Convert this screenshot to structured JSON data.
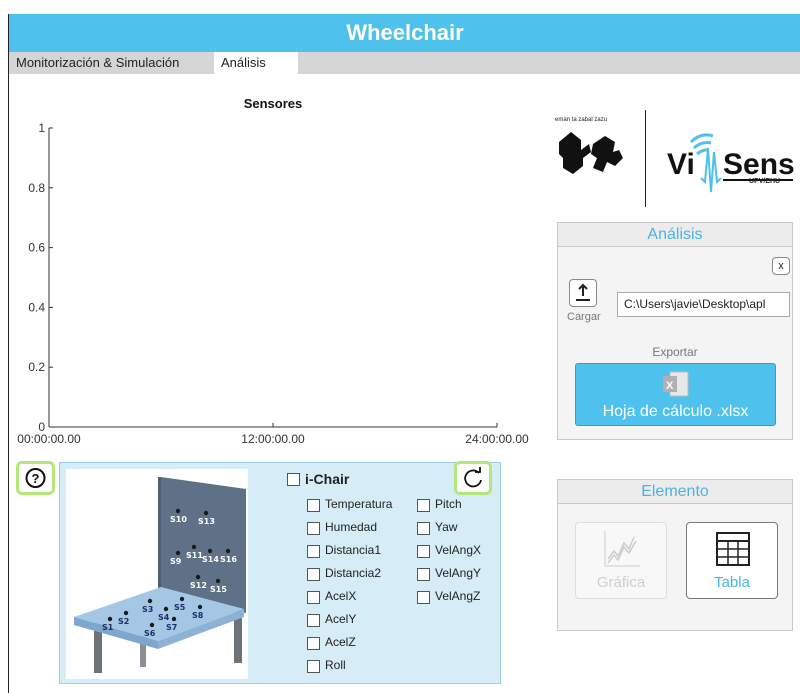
{
  "app": {
    "title": "Wheelchair"
  },
  "tabs": [
    {
      "label": "Monitorización & Simulación"
    },
    {
      "label": "Análisis"
    }
  ],
  "chart_data": {
    "type": "line",
    "title": "Sensores",
    "xlabel": "",
    "ylabel": "",
    "x_ticks": [
      "00:00:00.00",
      "12:00:00.00",
      "24:00:00.00"
    ],
    "y_ticks": [
      "0",
      "0.2",
      "0.4",
      "0.6",
      "0.8",
      "1"
    ],
    "ylim": [
      0,
      1
    ],
    "series": []
  },
  "logos": {
    "ehu_motto": "eman ta zabal zazu",
    "vinsens_sub": "UPV/EHU"
  },
  "analisis": {
    "title": "Análisis",
    "close_label": "x",
    "cargar_label": "Cargar",
    "path_value": "C:\\Users\\javie\\Desktop\\apl",
    "exportar_label": "Exportar",
    "export_button": "Hoja de cálculo .xlsx"
  },
  "elemento": {
    "title": "Elemento",
    "grafica": "Gráfica",
    "tabla": "Tabla"
  },
  "chair": {
    "ichair_label": "i-Chair",
    "sensors_col1": [
      "Temperatura",
      "Humedad",
      "Distancia1",
      "Distancia2",
      "AcelX",
      "AcelY",
      "AcelZ",
      "Roll"
    ],
    "sensors_col2": [
      "Pitch",
      "Yaw",
      "VelAngX",
      "VelAngY",
      "VelAngZ"
    ],
    "back_labels": [
      "S10",
      "S13",
      "S9",
      "S11",
      "S14",
      "S16",
      "S12",
      "S15"
    ],
    "seat_labels": [
      "S1",
      "S2",
      "S3",
      "S4",
      "S5",
      "S6",
      "S7",
      "S8"
    ]
  },
  "icons": {
    "help": "help-icon",
    "refresh": "refresh-icon",
    "upload": "upload-icon",
    "excel": "excel-icon",
    "line_chart": "line-chart-icon",
    "table": "table-icon"
  },
  "colors": {
    "accent": "#4ec1ec",
    "title_text": "#4ab4e6",
    "highlight": "#b5e67b",
    "chair_panel": "#d6ecf7"
  }
}
